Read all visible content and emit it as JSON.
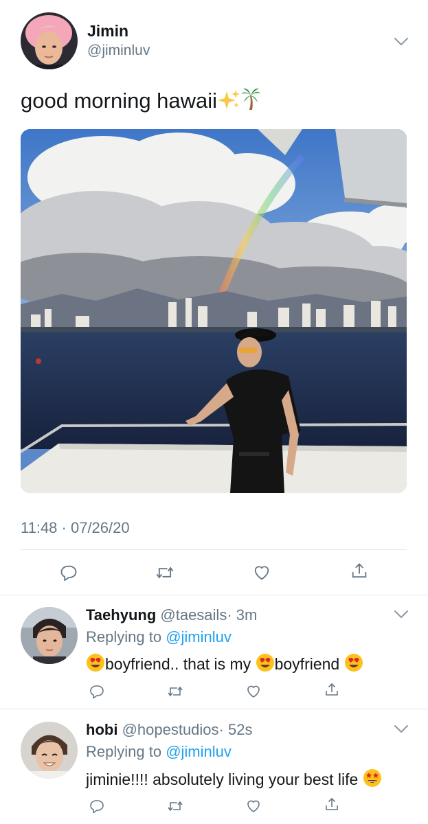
{
  "main_tweet": {
    "author_name": "Jimin",
    "author_handle": "@jiminluv",
    "text": "good morning hawaii",
    "emojis": [
      "sparkles",
      "palm-tree"
    ],
    "timestamp": "11:48 · 07/26/20",
    "actions": [
      "reply",
      "retweet",
      "like",
      "share"
    ]
  },
  "replies": [
    {
      "name": "Taehyung",
      "handle": "@taesails",
      "time": "· 3m",
      "replying_prefix": "Replying to",
      "replying_to": "@jiminluv",
      "text_part1": "boyfriend.. that is my",
      "text_part2": "boyfriend",
      "emoji": "heart-eyes"
    },
    {
      "name": "hobi",
      "handle": "@hopestudios",
      "time": "· 52s",
      "replying_prefix": "Replying to",
      "replying_to": "@jiminluv",
      "text": "jiminie!!!! absolutely living your best life",
      "emoji": "star-struck"
    }
  ],
  "colors": {
    "text": "#14171a",
    "secondary": "#657786",
    "link": "#1da1f2",
    "divider": "#e1e8ed"
  }
}
